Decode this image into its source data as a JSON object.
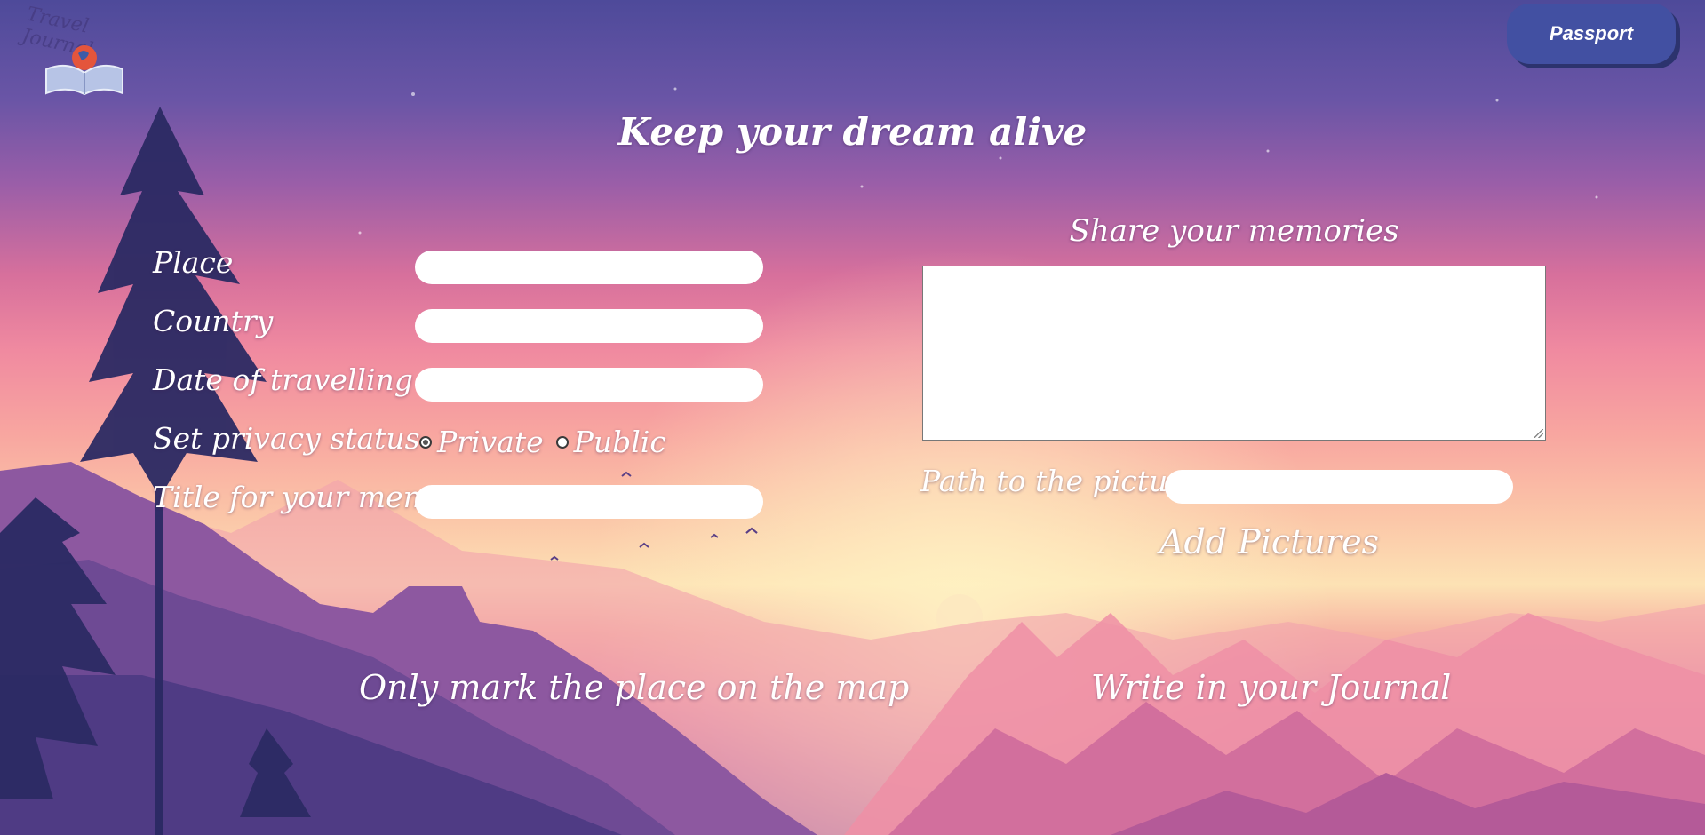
{
  "brand": {
    "logo_text": "Travel Journal"
  },
  "header": {
    "passport_label": "Passport"
  },
  "main": {
    "heading": "Keep your dream alive"
  },
  "form": {
    "place_label": "Place",
    "place_value": "",
    "country_label": "Country",
    "country_value": "",
    "date_label": "Date of travelling",
    "date_value": "",
    "privacy_label": "Set privacy status",
    "privacy_options": [
      "Private",
      "Public"
    ],
    "privacy_selected": "Private",
    "title_label": "Title for your memory",
    "title_value": ""
  },
  "memories": {
    "title": "Share your memories",
    "text_value": "",
    "path_label": "Path to the picture",
    "path_value": "",
    "add_pictures_label": "Add Pictures"
  },
  "footer": {
    "map_link": "Only mark the place on the map",
    "journal_link": "Write in your Journal"
  },
  "colors": {
    "passport_button": "#4250a2",
    "passport_shadow": "#2c336e",
    "text": "#ffffff",
    "input_bg": "#ffffff"
  }
}
